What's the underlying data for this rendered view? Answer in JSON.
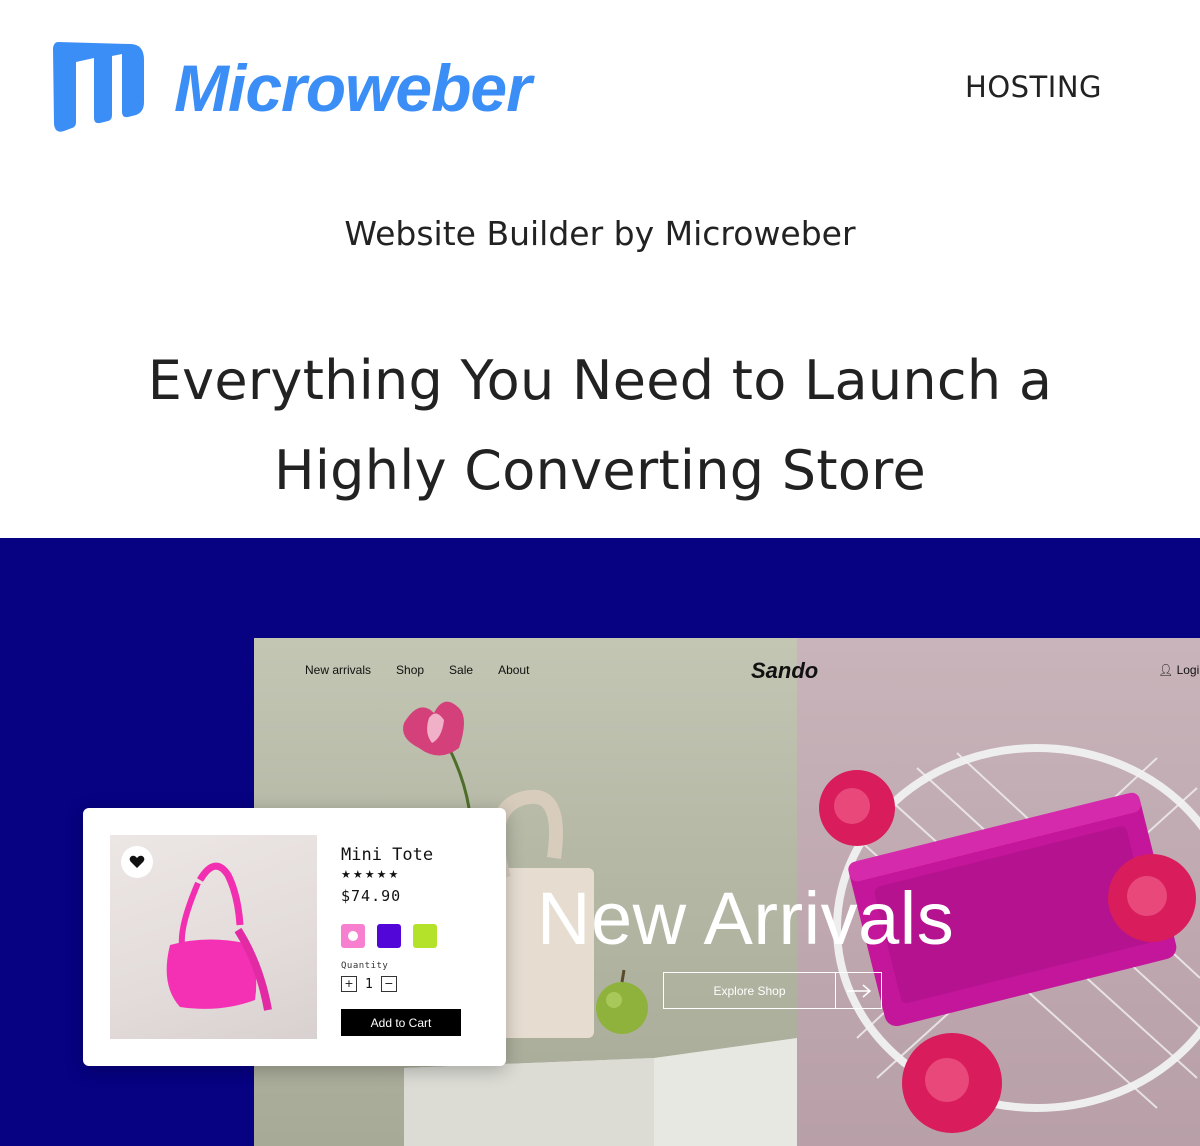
{
  "header": {
    "brand": "Microweber",
    "nav_hosting": "HOSTING",
    "brand_color": "#3b8ef5"
  },
  "subtitle": "Website Builder by Microweber",
  "headline": "Everything You Need to Launch a Highly Converting Store",
  "showcase": {
    "background_color": "#060282",
    "store": {
      "nav": [
        "New arrivals",
        "Shop",
        "Sale",
        "About"
      ],
      "brand": "Sando",
      "login": "Login",
      "hero_title": "New Arrivals",
      "cta": "Explore Shop"
    },
    "product": {
      "name": "Mini Tote",
      "rating": 5,
      "price": "$74.90",
      "colors": [
        "#f77fd0",
        "#5206d8",
        "#b4e22a"
      ],
      "selected_color": "#f77fd0",
      "quantity_label": "Quantity",
      "quantity": "1",
      "add_to_cart": "Add to Cart"
    }
  }
}
